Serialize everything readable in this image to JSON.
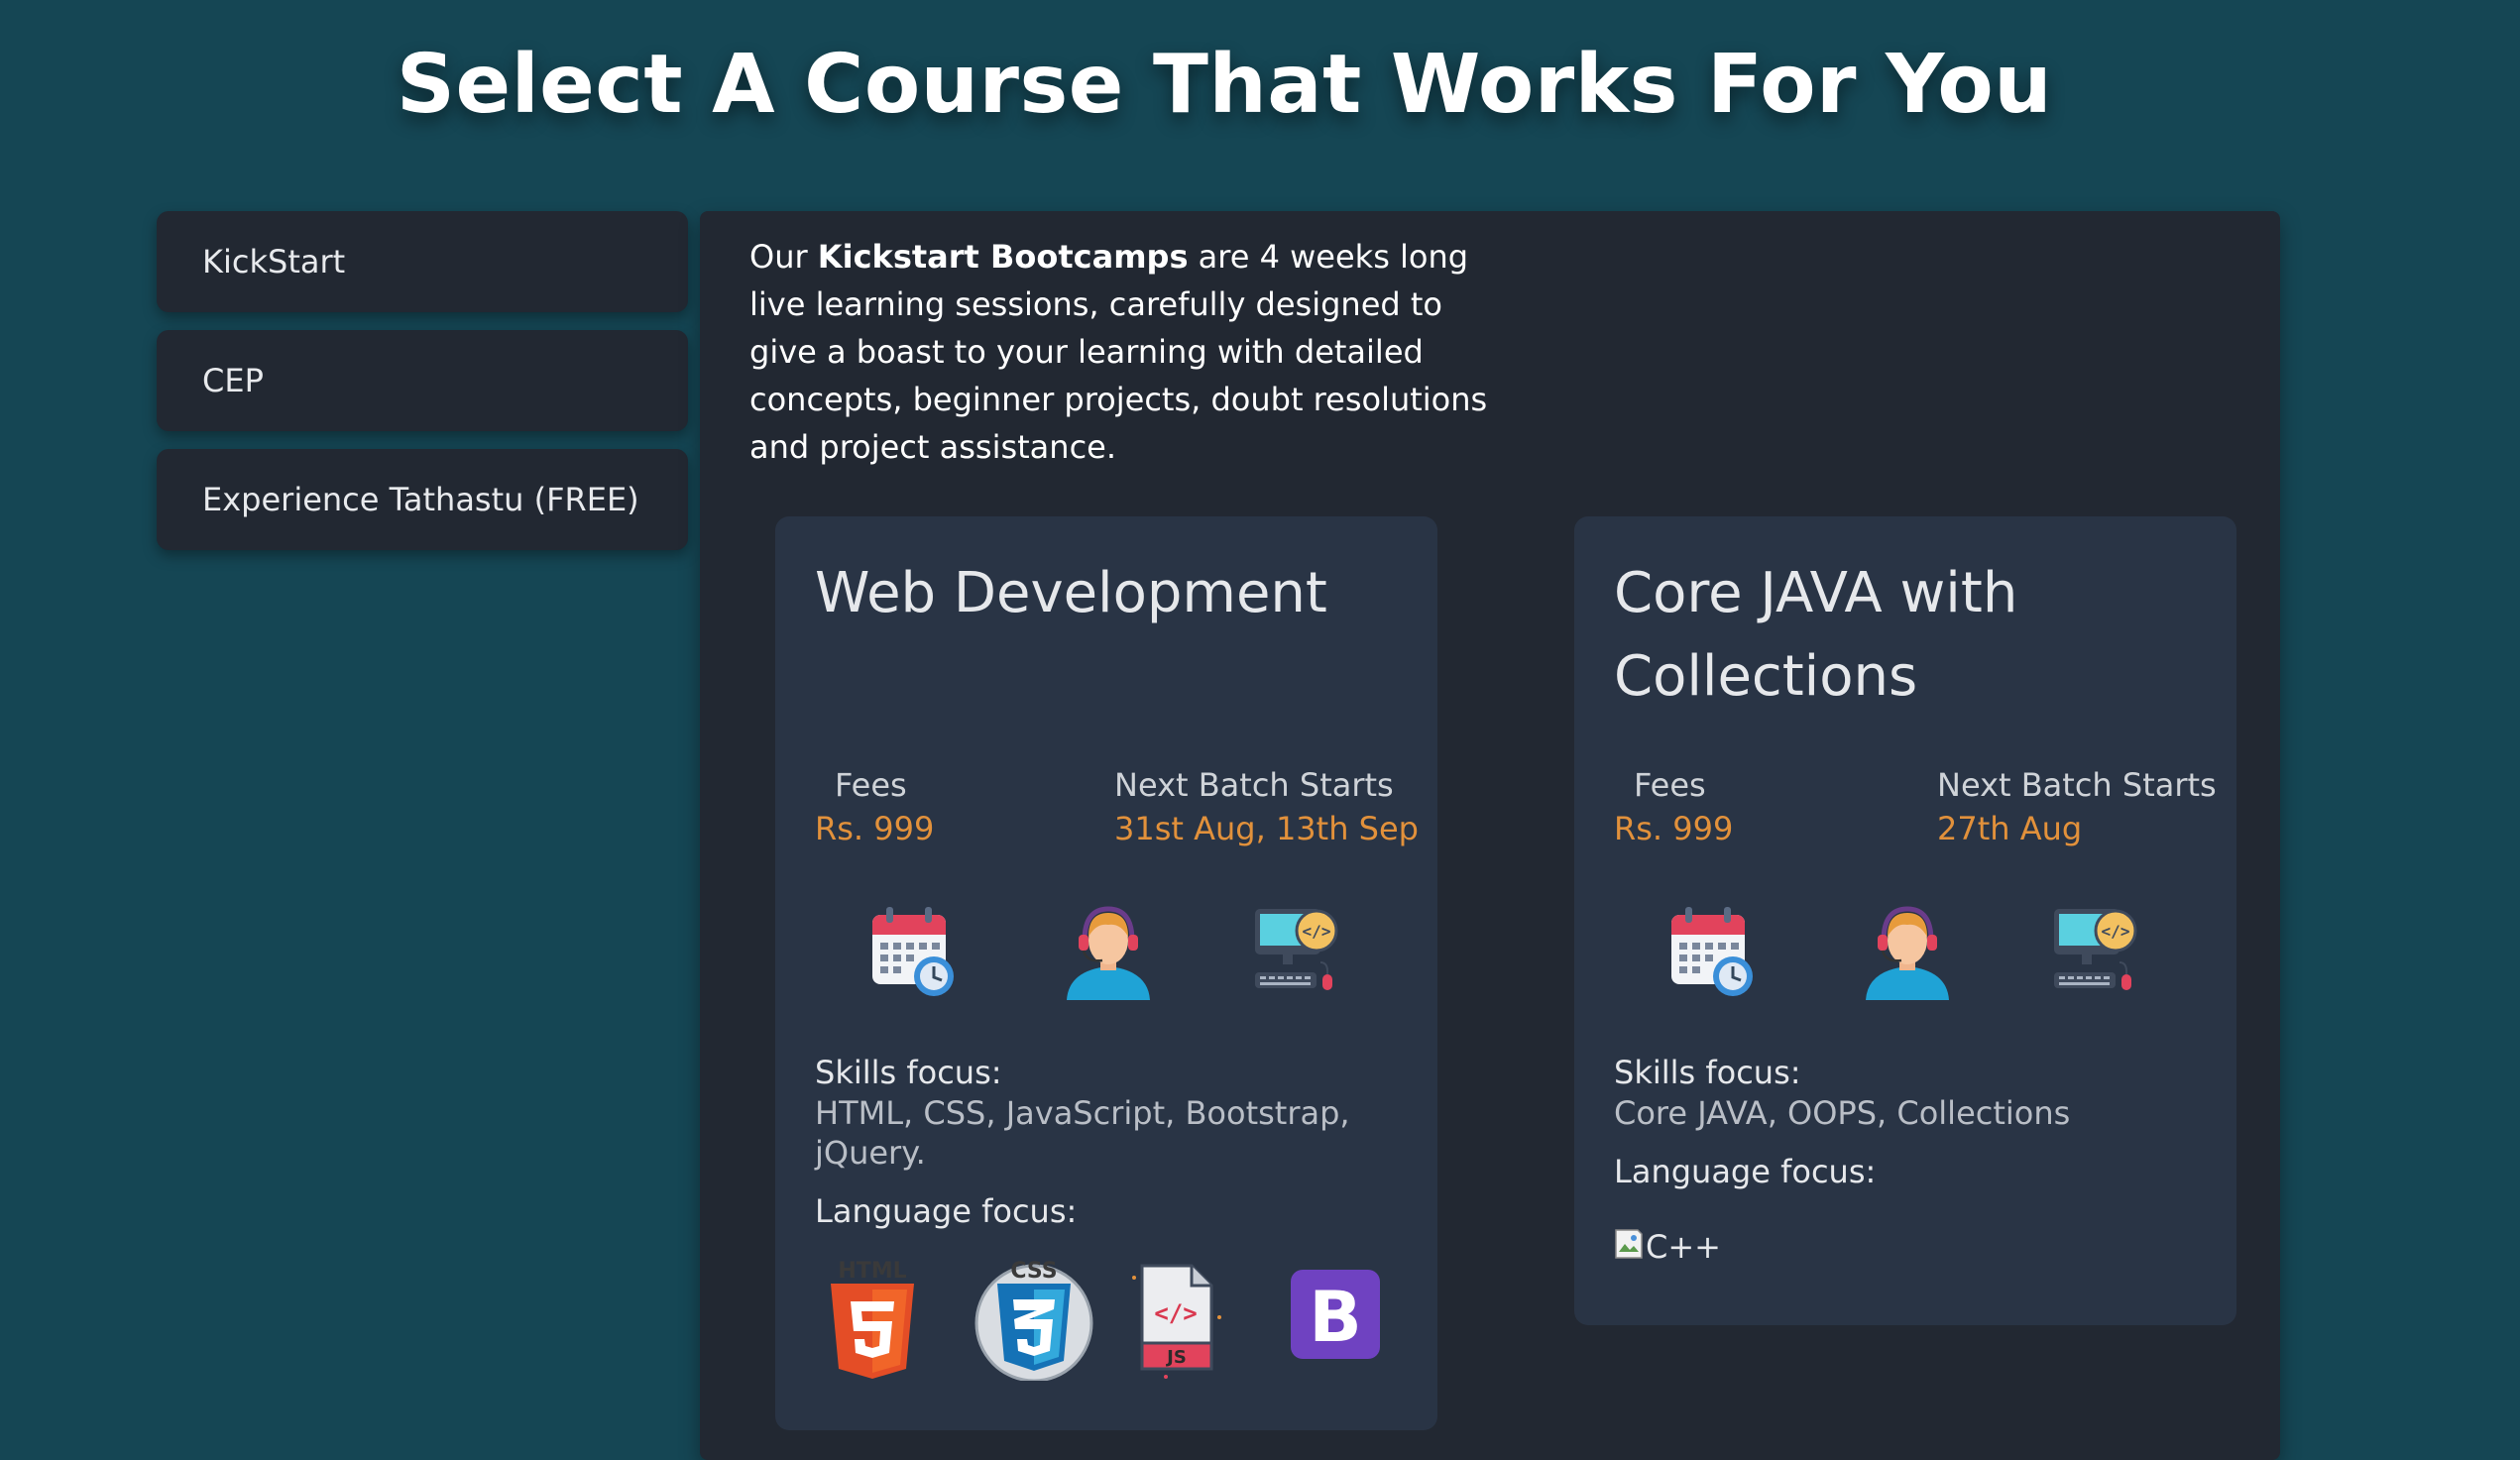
{
  "page": {
    "title": "Select A Course That Works For You"
  },
  "sidebar": {
    "tabs": [
      {
        "label": "KickStart"
      },
      {
        "label": "CEP"
      },
      {
        "label": "Experience Tathastu (FREE)"
      }
    ]
  },
  "intro": {
    "lead": "Our ",
    "highlight": "Kickstart Bootcamps",
    "rest": " are 4 weeks long live learning sessions, carefully designed to give a boast to your learning with detailed concepts, beginner projects, doubt resolutions and project assistance."
  },
  "cards": [
    {
      "title": "Web Development",
      "fees_label": "Fees",
      "fees_value": "Rs. 999",
      "batch_label": "Next Batch Starts",
      "batch_value": "31st Aug, 13th Sep",
      "icons": [
        "calendar-clock-icon",
        "support-agent-icon",
        "computer-code-icon"
      ],
      "skills_label": "Skills focus:",
      "skills_value": "HTML, CSS, JavaScript, Bootstrap, jQuery.",
      "language_label": "Language focus:",
      "languages": [
        {
          "icon": "html5-logo-icon",
          "text": "HTML"
        },
        {
          "icon": "css3-logo-icon",
          "text": "CSS"
        },
        {
          "icon": "javascript-file-icon",
          "text": "JS"
        },
        {
          "icon": "bootstrap-logo-icon",
          "text": "B"
        }
      ]
    },
    {
      "title": "Core JAVA with Collections",
      "fees_label": "Fees",
      "fees_value": "Rs. 999",
      "batch_label": "Next Batch Starts",
      "batch_value": "27th Aug",
      "icons": [
        "calendar-clock-icon",
        "support-agent-icon",
        "computer-code-icon"
      ],
      "skills_label": "Skills focus:",
      "skills_value": "Core JAVA, OOPS, Collections",
      "language_label": "Language focus:",
      "language_alt": "C++"
    }
  ],
  "colors": {
    "background": "#154654",
    "panel": "#222832",
    "card": "#293445",
    "accent": "#e2913b"
  }
}
